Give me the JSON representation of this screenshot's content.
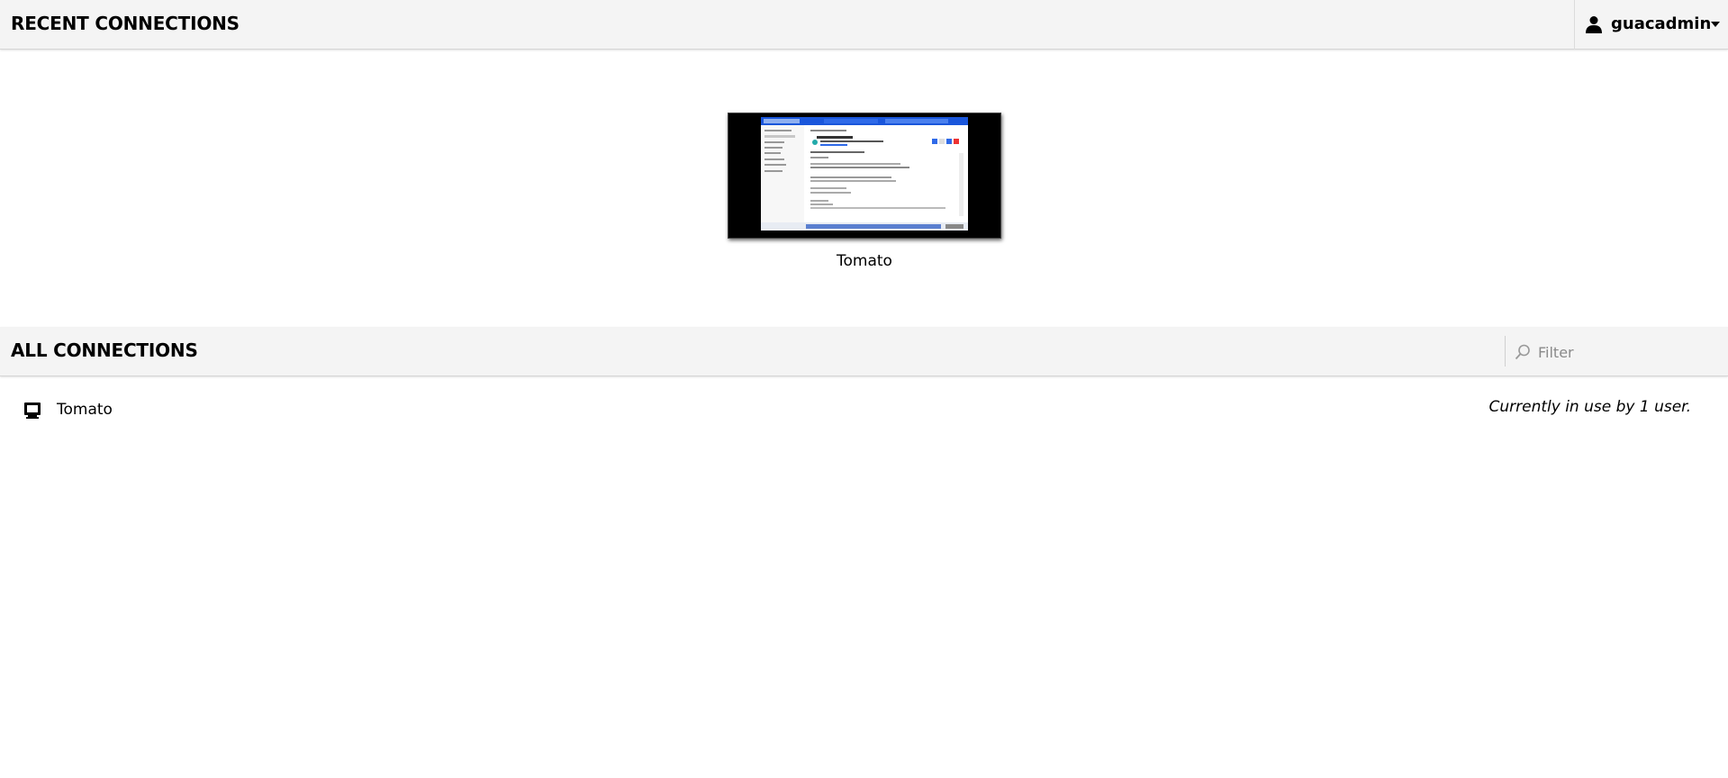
{
  "recent": {
    "title": "RECENT CONNECTIONS",
    "tiles": [
      {
        "name": "Tomato"
      }
    ]
  },
  "user_menu": {
    "username": "guacadmin",
    "icons": [
      "user-icon",
      "caret-down-icon"
    ]
  },
  "all": {
    "title": "ALL CONNECTIONS",
    "filter_placeholder": "Filter",
    "connections": [
      {
        "name": "Tomato",
        "status": "Currently in use by 1 user.",
        "icon": "monitor-icon"
      }
    ]
  }
}
